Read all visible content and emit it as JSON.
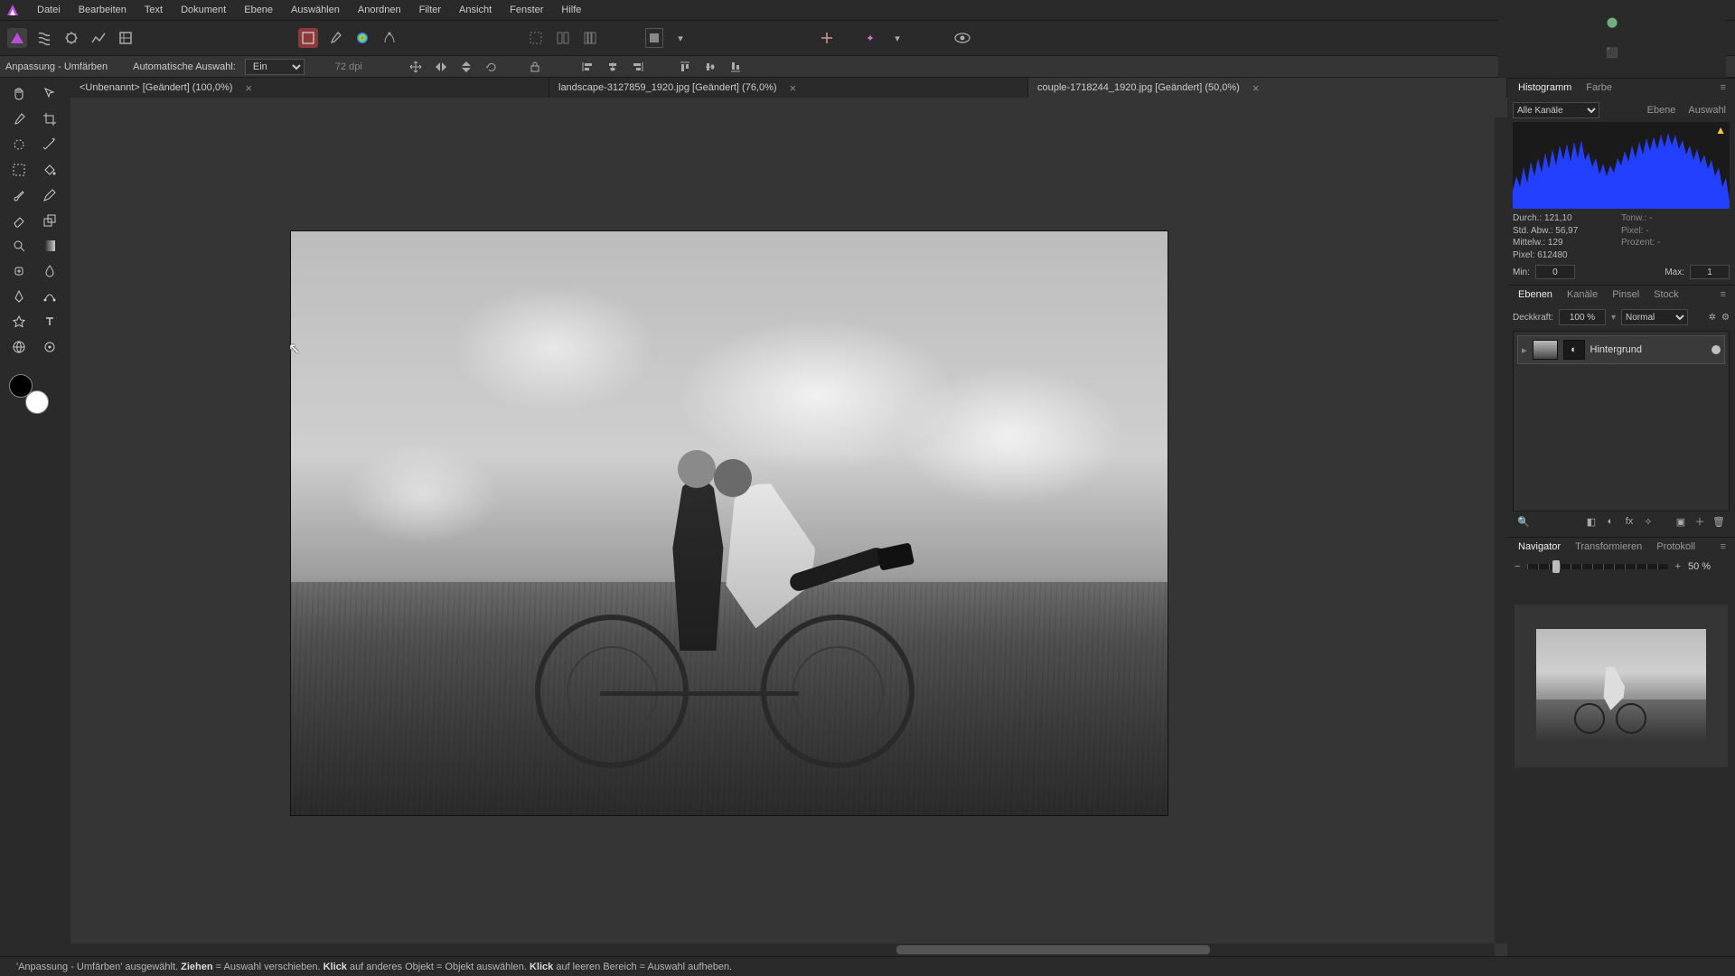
{
  "menu": {
    "items": [
      "Datei",
      "Bearbeiten",
      "Text",
      "Dokument",
      "Ebene",
      "Auswählen",
      "Anordnen",
      "Filter",
      "Ansicht",
      "Fenster",
      "Hilfe"
    ]
  },
  "context": {
    "tool_label": "Anpassung - Umfärben",
    "auto_select_label": "Automatische Auswahl:",
    "auto_select_value": "Ein",
    "dpi": "72 dpi"
  },
  "tabs": [
    {
      "title": "<Unbenannt> [Geändert] (100,0%)",
      "active": false
    },
    {
      "title": "landscape-3127859_1920.jpg [Geändert] (76,0%)",
      "active": false
    },
    {
      "title": "couple-1718244_1920.jpg [Geändert] (50,0%)",
      "active": true
    }
  ],
  "histogram": {
    "tab1": "Histogramm",
    "tab2": "Farbe",
    "channel": "Alle Kanäle",
    "sub1": "Ebene",
    "sub2": "Auswahl",
    "stats": {
      "durch_l": "Durch.:",
      "durch_v": "121,10",
      "tonw_l": "Tonw.:",
      "tonw_v": "-",
      "std_l": "Std. Abw.:",
      "std_v": "56,97",
      "pixel2_l": "Pixel:",
      "pixel2_v": "-",
      "mittel_l": "Mittelw.:",
      "mittel_v": "129",
      "proz_l": "Prozent:",
      "proz_v": "-",
      "pixel_l": "Pixel:",
      "pixel_v": "612480"
    },
    "min_l": "Min:",
    "min_v": "0",
    "max_l": "Max:",
    "max_v": "1"
  },
  "layers": {
    "tabs": [
      "Ebenen",
      "Kanäle",
      "Pinsel",
      "Stock"
    ],
    "opacity_l": "Deckkraft:",
    "opacity_v": "100 %",
    "blend": "Normal",
    "layer_name": "Hintergrund"
  },
  "navigator": {
    "tabs": [
      "Navigator",
      "Transformieren",
      "Protokoll"
    ],
    "zoom": "50 %"
  },
  "status": {
    "pre": "'Anpassung - Umfärben' ausgewählt. ",
    "b1": "Ziehen",
    "t1": " = Auswahl verschieben. ",
    "b2": "Klick",
    "t2": " auf anderes Objekt = Objekt auswählen. ",
    "b3": "Klick",
    "t3": " auf leeren Bereich = Auswahl aufheben."
  }
}
